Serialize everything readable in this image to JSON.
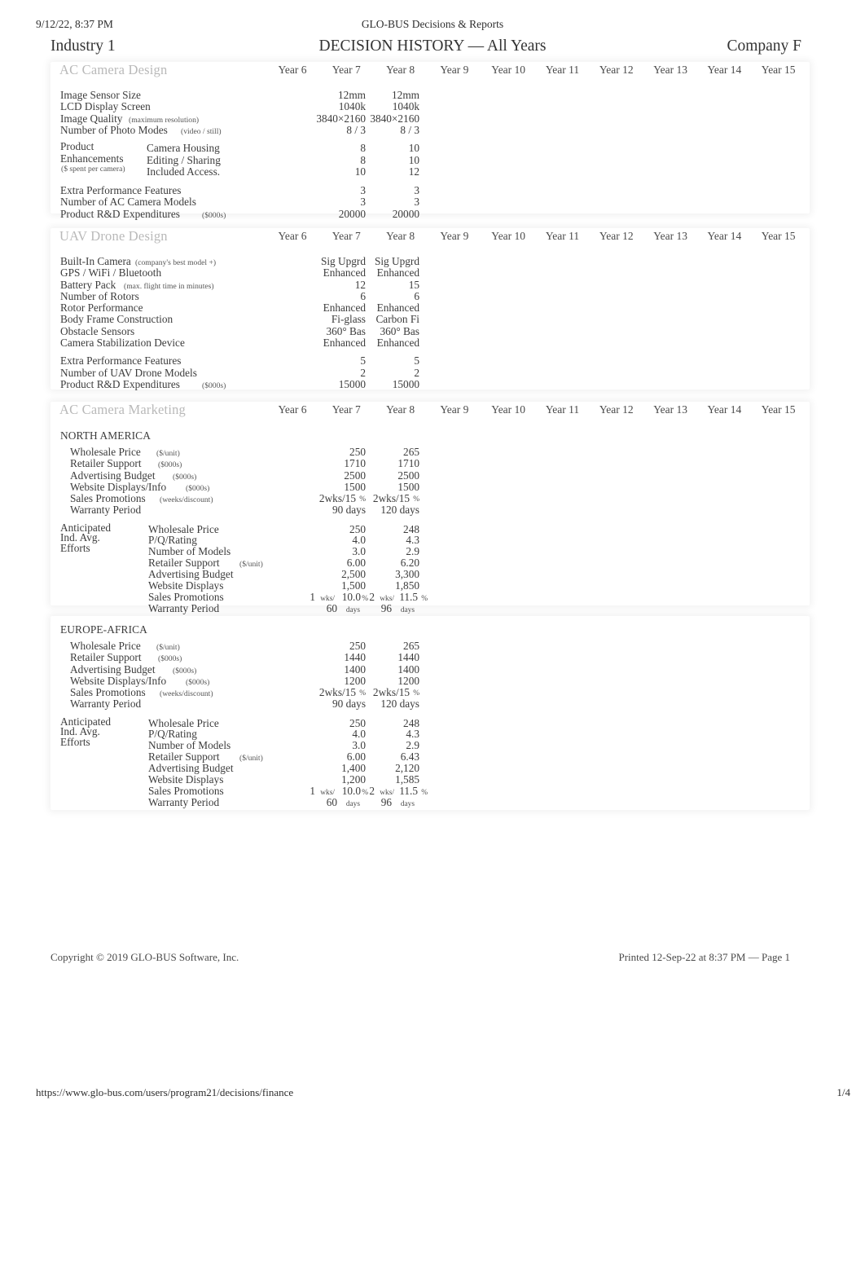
{
  "print_header": {
    "datetime": "9/12/22, 8:37 PM",
    "app_title": "GLO-BUS Decisions & Reports"
  },
  "title_row": {
    "industry": "Industry 1",
    "doc_title": "DECISION HISTORY — All Years",
    "company": "Company F"
  },
  "year_columns": [
    "Year 6",
    "Year 7",
    "Year 8",
    "Year 9",
    "Year 10",
    "Year 11",
    "Year 12",
    "Year 13",
    "Year 14",
    "Year 15"
  ],
  "sections": {
    "ac_camera_design": {
      "title": "AC Camera Design",
      "rows": [
        {
          "label": "Image Sensor Size",
          "sub": "",
          "y6": "12mm",
          "y7": "12mm"
        },
        {
          "label": "LCD Display Screen",
          "sub": "",
          "y6": "1040k",
          "y7": "1040k"
        },
        {
          "label": "Image Quality",
          "sub": "(maximum resolution)",
          "y6": "3840×2160",
          "y7": "3840×2160"
        },
        {
          "label": "Number of Photo Modes",
          "sub": "(video / still)",
          "y6": "8 / 3",
          "y7": "8 / 3"
        }
      ],
      "enhancements_group": {
        "line1": "Product",
        "line2": "Enhancements",
        "line3": "($ spent per camera)",
        "rows": [
          {
            "label": "Camera Housing",
            "y6": "8",
            "y7": "10"
          },
          {
            "label": "Editing / Sharing",
            "y6": "8",
            "y7": "10"
          },
          {
            "label": "Included Access.",
            "y6": "10",
            "y7": "12"
          }
        ]
      },
      "rows2": [
        {
          "label": "Extra Performance Features",
          "sub": "",
          "y6": "3",
          "y7": "3"
        },
        {
          "label": "Number of AC Camera Models",
          "sub": "",
          "y6": "3",
          "y7": "3"
        },
        {
          "label": "Product R&D Expenditures",
          "sub": "($000s)",
          "y6": "20000",
          "y7": "20000"
        }
      ]
    },
    "uav_drone_design": {
      "title": "UAV Drone Design",
      "rows": [
        {
          "label": "Built-In Camera",
          "sub": "(company's best model +)",
          "y6": "Sig Upgrd",
          "y7": "Sig Upgrd"
        },
        {
          "label": "GPS / WiFi / Bluetooth",
          "sub": "",
          "y6": "Enhanced",
          "y7": "Enhanced"
        },
        {
          "label": "Battery Pack",
          "sub": "(max. flight time in minutes)",
          "y6": "12",
          "y7": "15"
        },
        {
          "label": "Number of Rotors",
          "sub": "",
          "y6": "6",
          "y7": "6"
        },
        {
          "label": "Rotor Performance",
          "sub": "",
          "y6": "Enhanced",
          "y7": "Enhanced"
        },
        {
          "label": "Body Frame Construction",
          "sub": "",
          "y6": "Fi-glass",
          "y7": "Carbon Fi"
        },
        {
          "label": "Obstacle Sensors",
          "sub": "",
          "y6": "360° Bas",
          "y7": "360° Bas"
        },
        {
          "label": "Camera Stabilization Device",
          "sub": "",
          "y6": "Enhanced",
          "y7": "Enhanced"
        }
      ],
      "rows2": [
        {
          "label": "Extra Performance Features",
          "sub": "",
          "y6": "5",
          "y7": "5"
        },
        {
          "label": "Number of UAV Drone Models",
          "sub": "",
          "y6": "2",
          "y7": "2"
        },
        {
          "label": "Product R&D Expenditures",
          "sub": "($000s)",
          "y6": "15000",
          "y7": "15000"
        }
      ]
    },
    "ac_camera_marketing": {
      "title": "AC Camera Marketing",
      "regions": [
        {
          "name": "NORTH AMERICA",
          "rows": [
            {
              "label": "Wholesale Price",
              "sub": "($/unit)",
              "y6": "250",
              "y7": "265"
            },
            {
              "label": "Retailer Support",
              "sub": "($000s)",
              "y6": "1710",
              "y7": "1710"
            },
            {
              "label": "Advertising Budget",
              "sub": "($000s)",
              "y6": "2500",
              "y7": "2500"
            },
            {
              "label": "Website Displays/Info",
              "sub": "($000s)",
              "y6": "1500",
              "y7": "1500"
            },
            {
              "label": "Sales Promotions",
              "sub": "(weeks/discount)",
              "y6": "2wks/15",
              "y7": "2wks/15",
              "y6_unit": "%",
              "y7_unit": "%"
            },
            {
              "label": "Warranty Period",
              "sub": "",
              "y6": "90 days",
              "y7": "120 days"
            }
          ],
          "anticipated": {
            "line1": "Anticipated",
            "line2": "Ind. Avg.",
            "line3": "Efforts",
            "rows": [
              {
                "label": "Wholesale Price",
                "sub": "",
                "y6": "250",
                "y7": "248"
              },
              {
                "label": "P/Q/Rating",
                "sub": "",
                "y6": "4.0",
                "y7": "4.3"
              },
              {
                "label": "Number of Models",
                "sub": "",
                "y6": "3.0",
                "y7": "2.9"
              },
              {
                "label": "Retailer Support",
                "sub": "($/unit)",
                "y6": "6.00",
                "y7": "6.20"
              },
              {
                "label": "Advertising Budget",
                "sub": "",
                "y6": "2,500",
                "y7": "3,300"
              },
              {
                "label": "Website Displays",
                "sub": "",
                "y6": "1,500",
                "y7": "1,850"
              }
            ],
            "promo": {
              "label": "Sales Promotions",
              "y6_wks": "1",
              "y6_wks_unit": "wks/",
              "y6_pct": "10.0",
              "y6_pct_unit": "%",
              "y7_wks": "2",
              "y7_wks_unit": "wks/",
              "y7_pct": "11.5",
              "y7_pct_unit": "%"
            },
            "warranty": {
              "label": "Warranty Period",
              "y6": "60",
              "y6_unit": "days",
              "y7": "96",
              "y7_unit": "days"
            }
          }
        },
        {
          "name": "EUROPE-AFRICA",
          "rows": [
            {
              "label": "Wholesale Price",
              "sub": "($/unit)",
              "y6": "250",
              "y7": "265"
            },
            {
              "label": "Retailer Support",
              "sub": "($000s)",
              "y6": "1440",
              "y7": "1440"
            },
            {
              "label": "Advertising Budget",
              "sub": "($000s)",
              "y6": "1400",
              "y7": "1400"
            },
            {
              "label": "Website Displays/Info",
              "sub": "($000s)",
              "y6": "1200",
              "y7": "1200"
            },
            {
              "label": "Sales Promotions",
              "sub": "(weeks/discount)",
              "y6": "2wks/15",
              "y7": "2wks/15",
              "y6_unit": "%",
              "y7_unit": "%"
            },
            {
              "label": "Warranty Period",
              "sub": "",
              "y6": "90 days",
              "y7": "120 days"
            }
          ],
          "anticipated": {
            "line1": "Anticipated",
            "line2": "Ind. Avg.",
            "line3": "Efforts",
            "rows": [
              {
                "label": "Wholesale Price",
                "sub": "",
                "y6": "250",
                "y7": "248"
              },
              {
                "label": "P/Q/Rating",
                "sub": "",
                "y6": "4.0",
                "y7": "4.3"
              },
              {
                "label": "Number of Models",
                "sub": "",
                "y6": "3.0",
                "y7": "2.9"
              },
              {
                "label": "Retailer Support",
                "sub": "($/unit)",
                "y6": "6.00",
                "y7": "6.43"
              },
              {
                "label": "Advertising Budget",
                "sub": "",
                "y6": "1,400",
                "y7": "2,120"
              },
              {
                "label": "Website Displays",
                "sub": "",
                "y6": "1,200",
                "y7": "1,585"
              }
            ],
            "promo": {
              "label": "Sales Promotions",
              "y6_wks": "1",
              "y6_wks_unit": "wks/",
              "y6_pct": "10.0",
              "y6_pct_unit": "%",
              "y7_wks": "2",
              "y7_wks_unit": "wks/",
              "y7_pct": "11.5",
              "y7_pct_unit": "%"
            },
            "warranty": {
              "label": "Warranty Period",
              "y6": "60",
              "y6_unit": "days",
              "y7": "96",
              "y7_unit": "days"
            }
          }
        }
      ]
    }
  },
  "page_footer": {
    "copyright": "Copyright © 2019 GLO-BUS Software, Inc.",
    "printed": "Printed 12-Sep-22 at 8:37 PM — Page 1"
  },
  "browser_footer": {
    "url": "https://www.glo-bus.com/users/program21/decisions/finance",
    "pages": "1/4"
  }
}
